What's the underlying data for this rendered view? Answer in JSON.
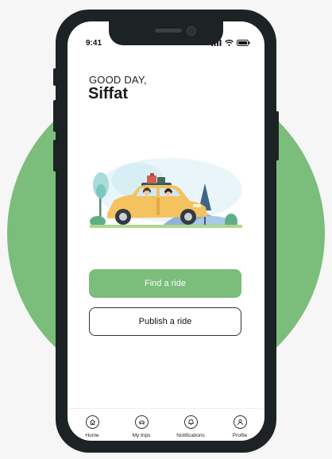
{
  "status_bar": {
    "time": "9:41"
  },
  "header": {
    "greeting": "GOOD DAY,",
    "user_name": "Siffat"
  },
  "actions": {
    "find_ride": "Find a ride",
    "publish_ride": "Publish a ride"
  },
  "tabbar": {
    "items": [
      {
        "label": "Home",
        "icon": "home-icon"
      },
      {
        "label": "My trips",
        "icon": "car-icon"
      },
      {
        "label": "Notifications",
        "icon": "bell-icon"
      },
      {
        "label": "Profile",
        "icon": "user-icon"
      }
    ]
  },
  "colors": {
    "accent": "#7bbd7b",
    "background": "#f6f6f6",
    "phone_frame": "#1d2225"
  }
}
